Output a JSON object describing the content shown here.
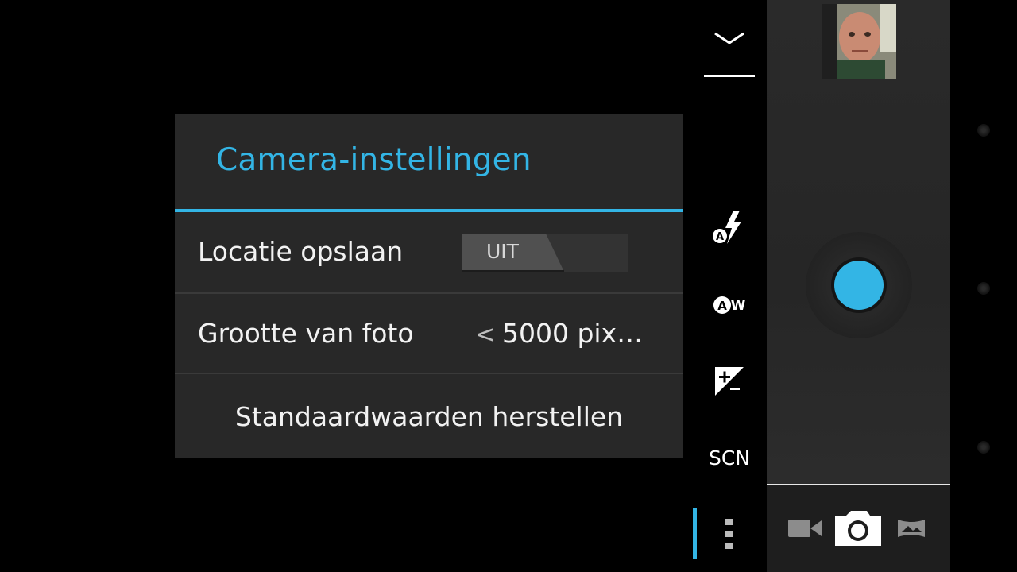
{
  "dialog": {
    "title": "Camera-instellingen",
    "location_label": "Locatie opslaan",
    "location_toggle_value": "UIT",
    "picture_size_label": "Grootte van foto",
    "picture_size_arrow": "<",
    "picture_size_value": "5000 pix…",
    "reset_label": "Standaardwaarden herstellen"
  },
  "strip": {
    "collapse_icon": "chevron-down-icon",
    "flash_icon": "flash-auto-icon",
    "white_balance_icon": "white-balance-auto-icon",
    "exposure_icon": "exposure-icon",
    "scene_label": "SCN",
    "more_icon": "more-vert-icon"
  },
  "panel": {
    "thumbnail_icon": "last-photo-thumbnail",
    "shutter_icon": "shutter-button",
    "modes": [
      "video-camera-icon",
      "camera-icon",
      "panorama-icon"
    ],
    "active_mode": "camera"
  },
  "colors": {
    "accent": "#33b5e5",
    "background": "#000000",
    "dialog_bg": "#282828"
  }
}
